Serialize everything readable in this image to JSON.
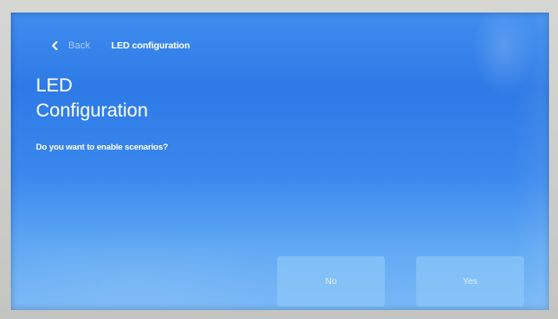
{
  "header": {
    "back_label": "Back",
    "title": "LED configuration"
  },
  "main": {
    "title": "LED\nConfiguration",
    "question": "Do you want to enable scenarios?"
  },
  "actions": {
    "no_label": "No",
    "yes_label": "Yes"
  },
  "icons": {
    "back": "chevron-left-icon"
  },
  "colors": {
    "screen_background": "#3a88ee",
    "button_background": "#8cc8f8",
    "text": "#ffffff"
  }
}
